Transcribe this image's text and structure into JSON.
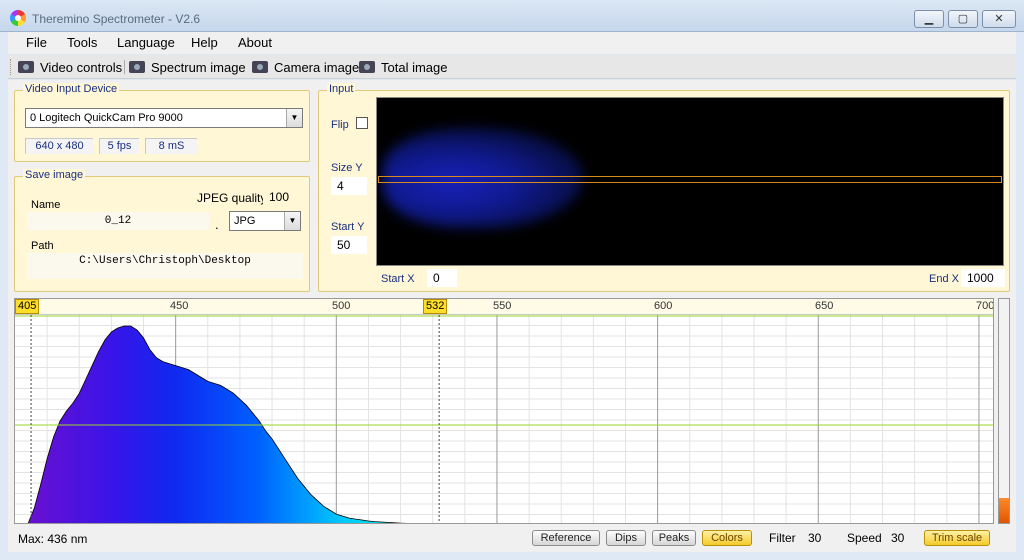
{
  "window": {
    "title": "Theremino Spectrometer - V2.6",
    "minimize": "▁",
    "maximize": "▢",
    "close": "✕"
  },
  "menu": {
    "items": [
      "File",
      "Tools",
      "Language",
      "Help",
      "About"
    ]
  },
  "toolbar": {
    "video_controls": "Video controls",
    "spectrum_image": "Spectrum image",
    "camera_image": "Camera image",
    "total_image": "Total image"
  },
  "video_input": {
    "title": "Video Input Device",
    "device": "0 Logitech QuickCam Pro 9000",
    "resolution": "640 x 480",
    "fps": "5 fps",
    "exposure": "8 mS"
  },
  "save_image": {
    "title": "Save image",
    "jpeg_quality_label": "JPEG quality",
    "jpeg_quality": "100",
    "name_label": "Name",
    "name_value": "0_12",
    "dot": ".",
    "format": "JPG",
    "path_label": "Path",
    "path_value": "C:\\Users\\Christoph\\Desktop"
  },
  "input": {
    "title": "Input",
    "flip_label": "Flip",
    "flip_checked": false,
    "size_y_label": "Size Y",
    "size_y": "4",
    "start_y_label": "Start Y",
    "start_y": "50",
    "start_x_label": "Start X",
    "start_x": "0",
    "end_x_label": "End X",
    "end_x": "1000"
  },
  "spectrum": {
    "scale_labels": [
      "450",
      "500",
      "550",
      "600",
      "650",
      "700"
    ],
    "marker_left": "405",
    "marker_mid": "532",
    "level_fraction": 0.11
  },
  "status": {
    "max_text": "Max: 436 nm",
    "reference": "Reference",
    "dips": "Dips",
    "peaks": "Peaks",
    "colors": "Colors",
    "filter_label": "Filter",
    "filter_value": "30",
    "speed_label": "Speed",
    "speed_value": "30",
    "trim_scale": "Trim scale"
  },
  "chart_data": {
    "type": "area",
    "xlabel": "",
    "ylabel": "",
    "xlim": [
      400,
      705
    ],
    "ylim": [
      0,
      1
    ],
    "x_ticks": [
      450,
      500,
      550,
      600,
      650,
      700
    ],
    "markers": [
      405,
      532
    ],
    "max_nm": 436,
    "grid": true,
    "x": [
      404,
      406,
      408,
      410,
      412,
      414,
      416,
      418,
      420,
      422,
      424,
      426,
      428,
      430,
      432,
      434,
      436,
      438,
      440,
      442,
      444,
      446,
      448,
      450,
      452,
      454,
      456,
      458,
      460,
      462,
      464,
      466,
      468,
      470,
      472,
      474,
      476,
      478,
      480,
      482,
      484,
      486,
      488,
      490,
      492,
      494,
      496,
      498,
      500,
      502,
      504,
      506,
      508,
      510,
      512,
      514,
      516,
      518,
      520,
      522,
      524,
      526,
      528,
      530,
      532,
      534
    ],
    "y": [
      0.0,
      0.08,
      0.2,
      0.33,
      0.44,
      0.52,
      0.57,
      0.61,
      0.66,
      0.73,
      0.8,
      0.87,
      0.93,
      0.97,
      0.99,
      1.0,
      1.0,
      0.98,
      0.94,
      0.88,
      0.84,
      0.82,
      0.81,
      0.8,
      0.79,
      0.78,
      0.76,
      0.74,
      0.72,
      0.71,
      0.7,
      0.68,
      0.66,
      0.63,
      0.6,
      0.56,
      0.52,
      0.47,
      0.43,
      0.38,
      0.33,
      0.28,
      0.23,
      0.19,
      0.15,
      0.12,
      0.09,
      0.07,
      0.05,
      0.04,
      0.03,
      0.025,
      0.02,
      0.015,
      0.012,
      0.01,
      0.008,
      0.006,
      0.004,
      0.003,
      0.002,
      0.002,
      0.001,
      0.001,
      0.0,
      0.0
    ]
  }
}
